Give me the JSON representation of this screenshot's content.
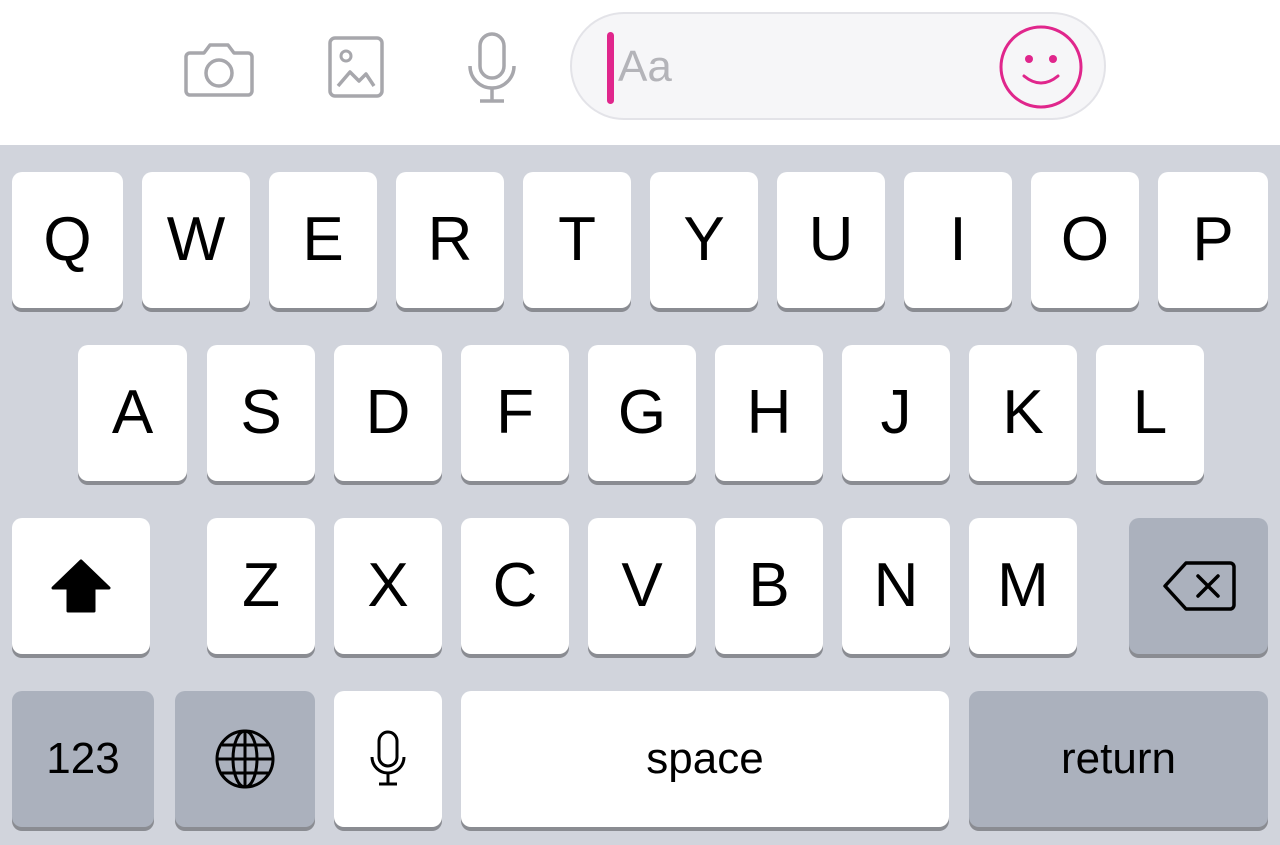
{
  "composer": {
    "input_placeholder": "Aa",
    "accent_color": "#e0268c",
    "icons": [
      "camera-icon",
      "photo-gallery-icon",
      "microphone-icon",
      "emoji-icon"
    ]
  },
  "keyboard": {
    "row1": [
      "Q",
      "W",
      "E",
      "R",
      "T",
      "Y",
      "U",
      "I",
      "O",
      "P"
    ],
    "row2": [
      "A",
      "S",
      "D",
      "F",
      "G",
      "H",
      "J",
      "K",
      "L"
    ],
    "row3": [
      "Z",
      "X",
      "C",
      "V",
      "B",
      "N",
      "M"
    ],
    "numbers_label": "123",
    "space_label": "space",
    "return_label": "return",
    "special_icons": [
      "shift-icon",
      "delete-icon",
      "globe-icon",
      "dictation-mic-icon"
    ]
  }
}
